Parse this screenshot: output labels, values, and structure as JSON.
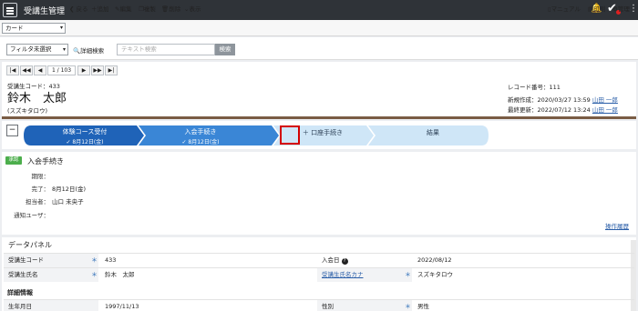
{
  "header": {
    "title": "受講生管理"
  },
  "toolbar": {
    "view_select": "カード",
    "buttons": {
      "back": "戻る",
      "add": "追加",
      "edit": "編集",
      "copy": "複製",
      "delete": "削除",
      "display": "表示",
      "manual": "マニュアル",
      "print": "印刷",
      "admin": "管理"
    }
  },
  "filter": {
    "select": "フィルタ未選択",
    "detail_search": "詳細検索",
    "search_placeholder": "テキスト検索",
    "search_button": "検索"
  },
  "pager": {
    "first": "|◀",
    "prev_many": "◀◀",
    "prev": "◀",
    "page": "1 / 103",
    "next": "▶",
    "next_many": "▶▶",
    "last": "▶|"
  },
  "record": {
    "code_line": "受講生コード：433",
    "name": "鈴木　太郎",
    "kana": "(スズキタロウ)",
    "record_no": "レコード番号：111",
    "created": "新規作成：2020/03/27 13:59",
    "created_by": "山田 一郎",
    "updated": "最終更新：2022/07/12 13:24",
    "updated_by": "山田 一郎"
  },
  "workflow": {
    "collapse": "−",
    "steps": [
      {
        "label": "体験コース受付",
        "date": "✓ 8月12日(金)"
      },
      {
        "label": "入会手続き",
        "date": "✓ 8月12日(金)"
      },
      {
        "label": "＋ 口座手続き",
        "date": ""
      },
      {
        "label": "結果",
        "date": ""
      }
    ]
  },
  "procedure": {
    "badge": "承認",
    "title": "入会手続き",
    "fields": [
      {
        "label": "期限：",
        "value": ""
      },
      {
        "label": "完了：",
        "value": "8月12日(金)"
      },
      {
        "label": "担当者：",
        "value": "山口 未央子"
      },
      {
        "label": "通知ユーザ：",
        "value": ""
      }
    ],
    "history": "操作履歴"
  },
  "data_panel": {
    "title": "データパネル",
    "rows": [
      {
        "l1": "受講生コード",
        "v1": "433",
        "l2": "入会日",
        "v2": "2022/08/12"
      },
      {
        "l1": "受講生氏名",
        "v1": "鈴木　太郎",
        "l2": "受講生氏名カナ",
        "v2": "スズキタロウ"
      }
    ],
    "section": "詳細情報",
    "row3": {
      "l1": "生年月日",
      "v1": "1997/11/13",
      "l2": "性別",
      "v2": "男性"
    },
    "required_mark": "＊",
    "help_icon": "?"
  },
  "colors": {
    "step_active": "#1f63b8",
    "step_mid": "#3a86d6",
    "step_pending": "#cfe6f7",
    "highlight": "#d40000",
    "approve": "#4cae4c"
  }
}
